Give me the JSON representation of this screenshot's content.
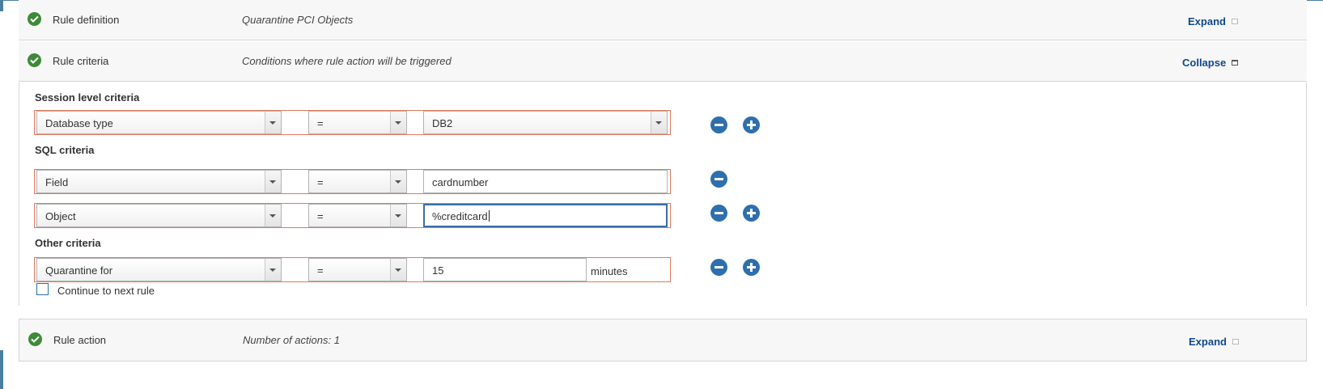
{
  "sections": {
    "definition": {
      "title": "Rule definition",
      "description": "Quarantine PCI Objects",
      "toggle": "Expand"
    },
    "criteria": {
      "title": "Rule criteria",
      "description": "Conditions where rule action will be triggered",
      "toggle": "Collapse"
    },
    "action": {
      "title": "Rule action",
      "description": "Number of actions: 1",
      "toggle": "Expand"
    }
  },
  "groups": {
    "session": "Session level criteria",
    "sql": "SQL criteria",
    "other": "Other criteria"
  },
  "rows": [
    {
      "field": "Database type",
      "operator": "=",
      "value": "DB2"
    },
    {
      "field": "Field",
      "operator": "=",
      "value": "cardnumber"
    },
    {
      "field": "Object",
      "operator": "=",
      "value": "%creditcard"
    },
    {
      "field": "Quarantine for",
      "operator": "=",
      "value": "15",
      "unit": "minutes"
    }
  ],
  "continue_label": "Continue to next rule",
  "colors": {
    "accent": "#2e6fae",
    "error_border": "#e07a5f",
    "success": "#3f8a3a",
    "link": "#10488a"
  },
  "icons": [
    "check-circle-icon",
    "minus-circle-icon",
    "plus-circle-icon",
    "dropdown-arrow-icon",
    "collapse-box-icon"
  ]
}
